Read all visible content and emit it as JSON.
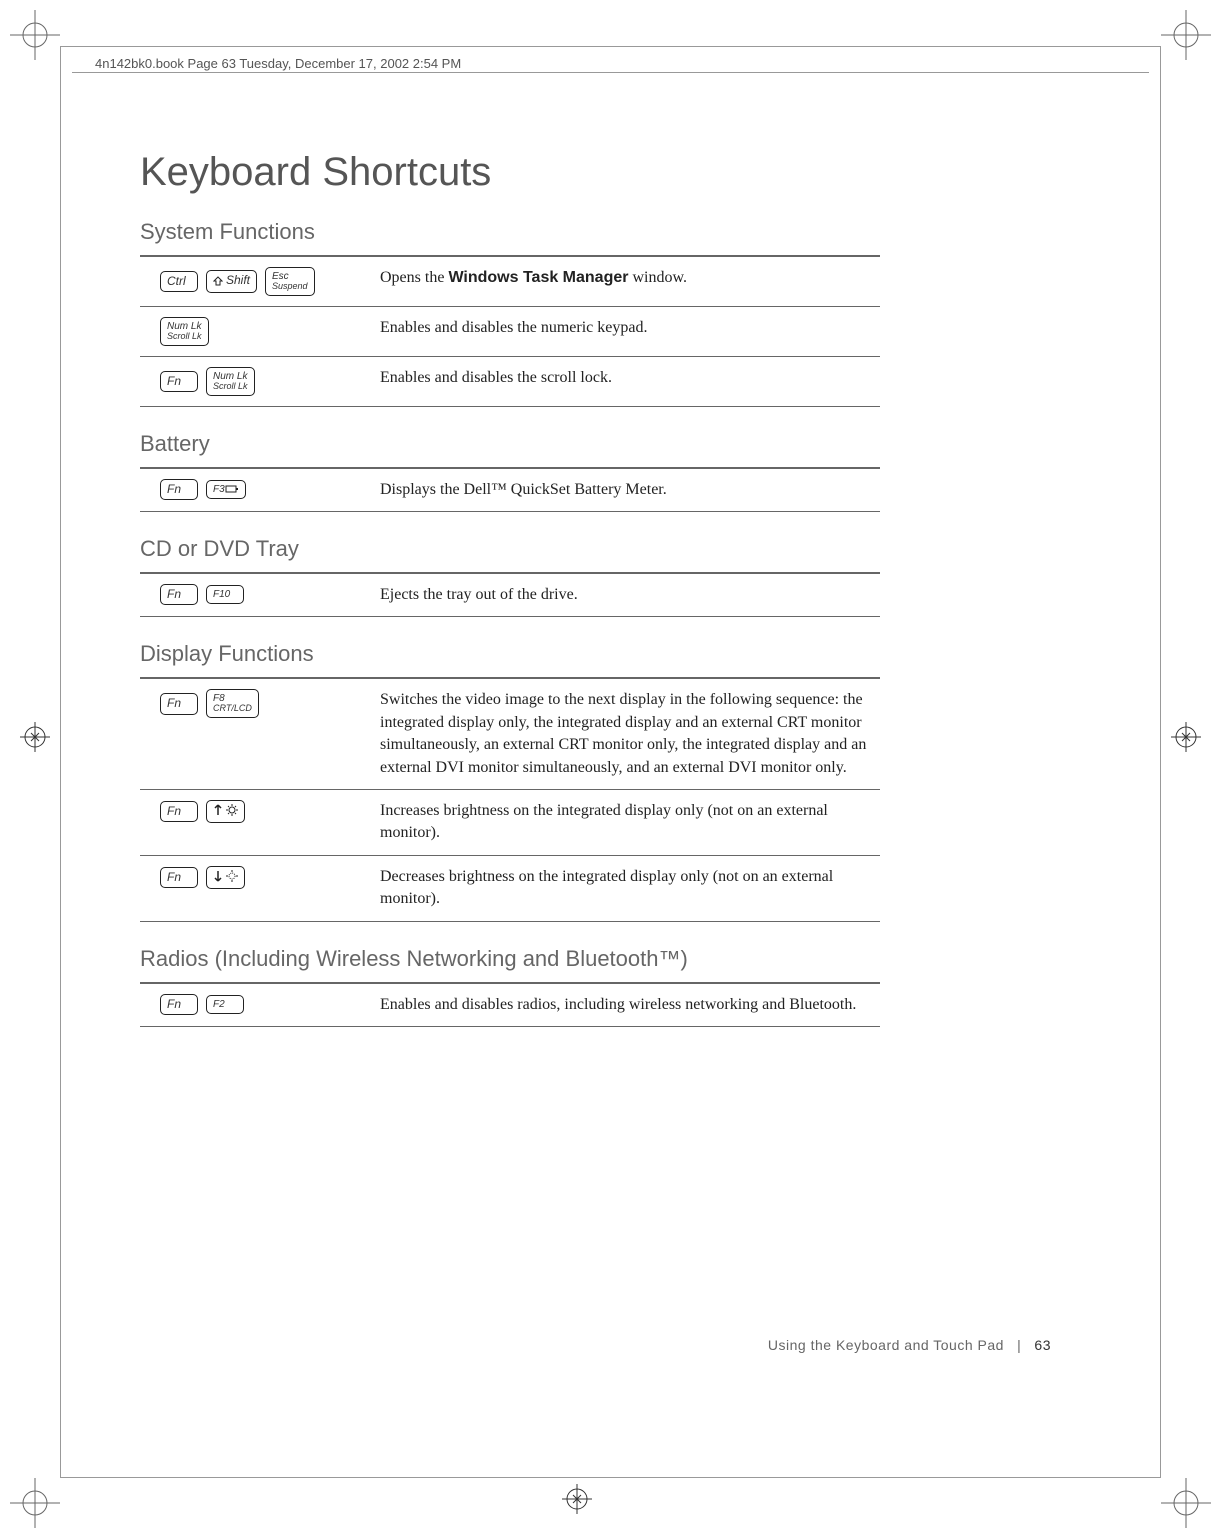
{
  "header": "4n142bk0.book  Page 63  Tuesday, December 17, 2002  2:54 PM",
  "title": "Keyboard Shortcuts",
  "sections": {
    "system": {
      "heading": "System Functions",
      "rows": [
        {
          "keys": [
            "Ctrl",
            "Shift",
            "Esc / Suspend"
          ],
          "desc_pre": "Opens the ",
          "desc_bold": "Windows Task Manager",
          "desc_post": " window."
        },
        {
          "keys": [
            "Num Lk / Scroll Lk"
          ],
          "desc": "Enables and disables the numeric keypad."
        },
        {
          "keys": [
            "Fn",
            "Num Lk / Scroll Lk"
          ],
          "desc": "Enables and disables the scroll lock."
        }
      ]
    },
    "battery": {
      "heading": "Battery",
      "rows": [
        {
          "keys": [
            "Fn",
            "F3"
          ],
          "desc": "Displays the Dell™ QuickSet Battery Meter."
        }
      ]
    },
    "tray": {
      "heading": "CD or DVD Tray",
      "rows": [
        {
          "keys": [
            "Fn",
            "F10"
          ],
          "desc": "Ejects the tray out of the drive."
        }
      ]
    },
    "display": {
      "heading": "Display Functions",
      "rows": [
        {
          "keys": [
            "Fn",
            "F8 / CRT/LCD"
          ],
          "desc": "Switches the video image to the next display in the following sequence: the integrated display only, the integrated display and an external CRT monitor simultaneously, an external CRT monitor only, the integrated display and an external DVI monitor simultaneously, and an external DVI monitor only."
        },
        {
          "keys": [
            "Fn",
            "brightness-up"
          ],
          "desc": "Increases brightness on the integrated display only (not on an external monitor)."
        },
        {
          "keys": [
            "Fn",
            "brightness-down"
          ],
          "desc": "Decreases brightness on the integrated display only (not on an external monitor)."
        }
      ]
    },
    "radios": {
      "heading": "Radios (Including Wireless Networking and Bluetooth™)",
      "rows": [
        {
          "keys": [
            "Fn",
            "F2"
          ],
          "desc": "Enables and disables radios, including wireless networking and Bluetooth."
        }
      ]
    }
  },
  "footer": {
    "section": "Using the Keyboard and Touch Pad",
    "sep": "|",
    "page": "63"
  },
  "keylabels": {
    "ctrl": "Ctrl",
    "shift": "Shift",
    "esc_top": "Esc",
    "esc_bot": "Suspend",
    "numlk_top": "Num Lk",
    "numlk_bot": "Scroll Lk",
    "fn": "Fn",
    "f3": "F3",
    "f10": "F10",
    "f8_top": "F8",
    "f8_bot": "CRT/LCD",
    "f2": "F2"
  }
}
